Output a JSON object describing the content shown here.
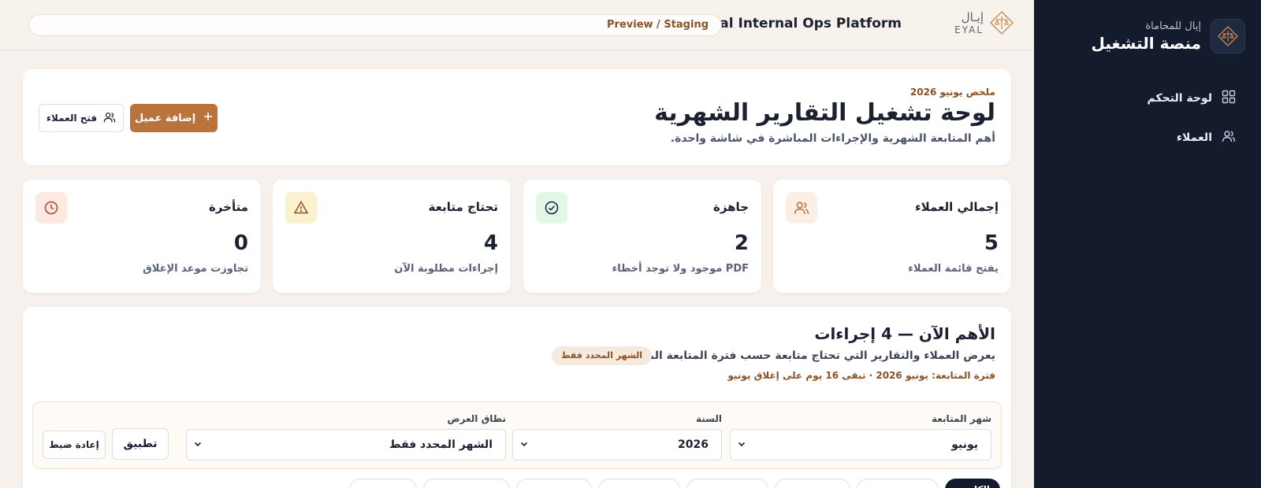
{
  "sidebar": {
    "brand_sub": "إيال للمحاماة",
    "brand_title": "منصة التشغيل",
    "logo_icon": "scales-icon",
    "nav": [
      {
        "label": "لوحة التحكم",
        "icon": "grid-icon"
      },
      {
        "label": "العملاء",
        "icon": "users-icon"
      }
    ],
    "background": "#131b2c"
  },
  "topbar": {
    "logo_ar": "إيـال",
    "logo_en": "EYAL",
    "platform_name": "Eyal Internal Ops Platform",
    "environment": "Preview / Staging"
  },
  "hero": {
    "eyebrow": "ملخص يونيو 2026",
    "title": "لوحة تشغيل التقارير الشهرية",
    "description": "أهم المتابعة الشهرية والإجراءات المباشرة في شاشة واحدة.",
    "add_client": "إضافة عميل",
    "open_clients": "فتح العملاء"
  },
  "stats": [
    {
      "title": "إجمالي العملاء",
      "value": "5",
      "sub": "يفتح قائمة العملاء",
      "icon": "users-icon",
      "icon_bg": "#fbeee4",
      "icon_color": "#b8743a"
    },
    {
      "title": "جاهزة",
      "value": "2",
      "sub": "PDF موجود ولا توجد أخطاء",
      "icon": "check-circle-icon",
      "icon_bg": "#e3f6ea",
      "icon_color": "#1b2130"
    },
    {
      "title": "تحتاج متابعة",
      "value": "4",
      "sub": "إجراءات مطلوبة الآن",
      "icon": "warning-icon",
      "icon_bg": "#fcf1cf",
      "icon_color": "#8a5223"
    },
    {
      "title": "متأخرة",
      "value": "0",
      "sub": "تجاوزت موعد الإغلاق",
      "icon": "clock-icon",
      "icon_bg": "#fbe9e2",
      "icon_color": "#b3452b"
    }
  ],
  "actions": {
    "title": "الأهم الآن — 4 إجراءات",
    "description": "يعرض العملاء والتقارير التي تحتاج متابعة حسب فترة المتابعة المحددة.",
    "badge": "الشهر المحدد فقط",
    "period": "فترة المتابعة: يونيو 2026 · تبقى 16 يوم على إغلاق يونيو"
  },
  "filters": {
    "month_label": "شهر المتابعة",
    "month_value": "يونيو",
    "year_label": "السنة",
    "year_value": "2026",
    "scope_label": "نطاق العرض",
    "scope_value": "الشهر المحدد فقط",
    "apply": "تطبيق",
    "reset": "إعادة ضبط"
  },
  "chips": [
    "الكل",
    "",
    "",
    "",
    "",
    "",
    "",
    "",
    ""
  ],
  "accent": "#b8743a"
}
